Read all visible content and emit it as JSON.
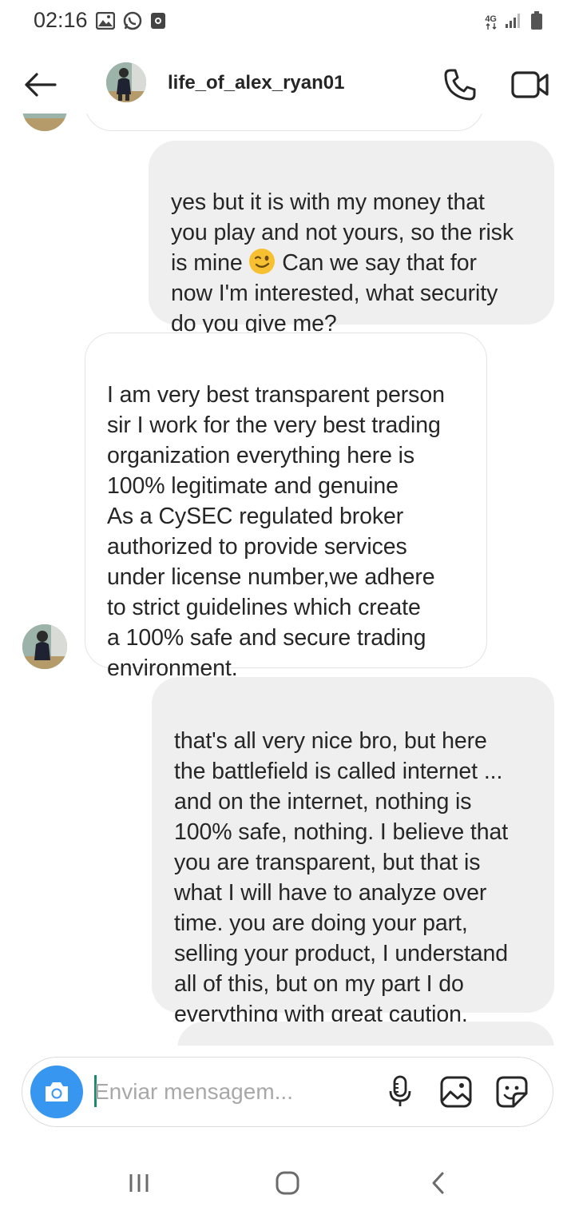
{
  "status_bar": {
    "time": "02:16",
    "network": "4G",
    "left_icons": [
      "gallery-icon",
      "whatsapp-icon",
      "app-notification-icon"
    ],
    "right_icons": [
      "signal-icon",
      "battery-icon"
    ]
  },
  "header": {
    "username": "life_of_alex_ryan01",
    "icons": [
      "back-arrow-icon",
      "phone-call-icon",
      "video-call-icon"
    ]
  },
  "messages": [
    {
      "side": "sent",
      "before_emoji": "yes but it is with my money that\nyou play and not yours, so the risk\nis mine ",
      "emoji": "winking-face-emoji",
      "after_emoji": " Can we say that for\nnow I'm interested, what security\ndo you give me?"
    },
    {
      "side": "received",
      "text": "I am very best transparent person\nsir I work for the very best trading\norganization everything here is\n100% legitimate and genuine\nAs a CySEC regulated broker\nauthorized to provide services\nunder license number,we adhere\nto strict guidelines which create\na 100% safe and secure trading\nenvironment."
    },
    {
      "side": "sent",
      "text": "that's all very nice bro, but here\nthe battlefield is called internet ...\nand on the internet, nothing is\n100% safe, nothing. I believe that\nyou are transparent, but that is\nwhat I will have to analyze over\ntime. you are doing your part,\nselling your product, I understand\nall of this, but on my part I do\neverything with great caution."
    }
  ],
  "composer": {
    "placeholder": "Enviar mensagem...",
    "value": "",
    "icons": [
      "camera-icon",
      "microphone-icon",
      "gallery-icon",
      "sticker-icon"
    ]
  },
  "colors": {
    "accent": "#3797f0",
    "sent_bubble": "#efefef",
    "received_border": "#e3e3e3",
    "caret": "#1b8a6b"
  }
}
